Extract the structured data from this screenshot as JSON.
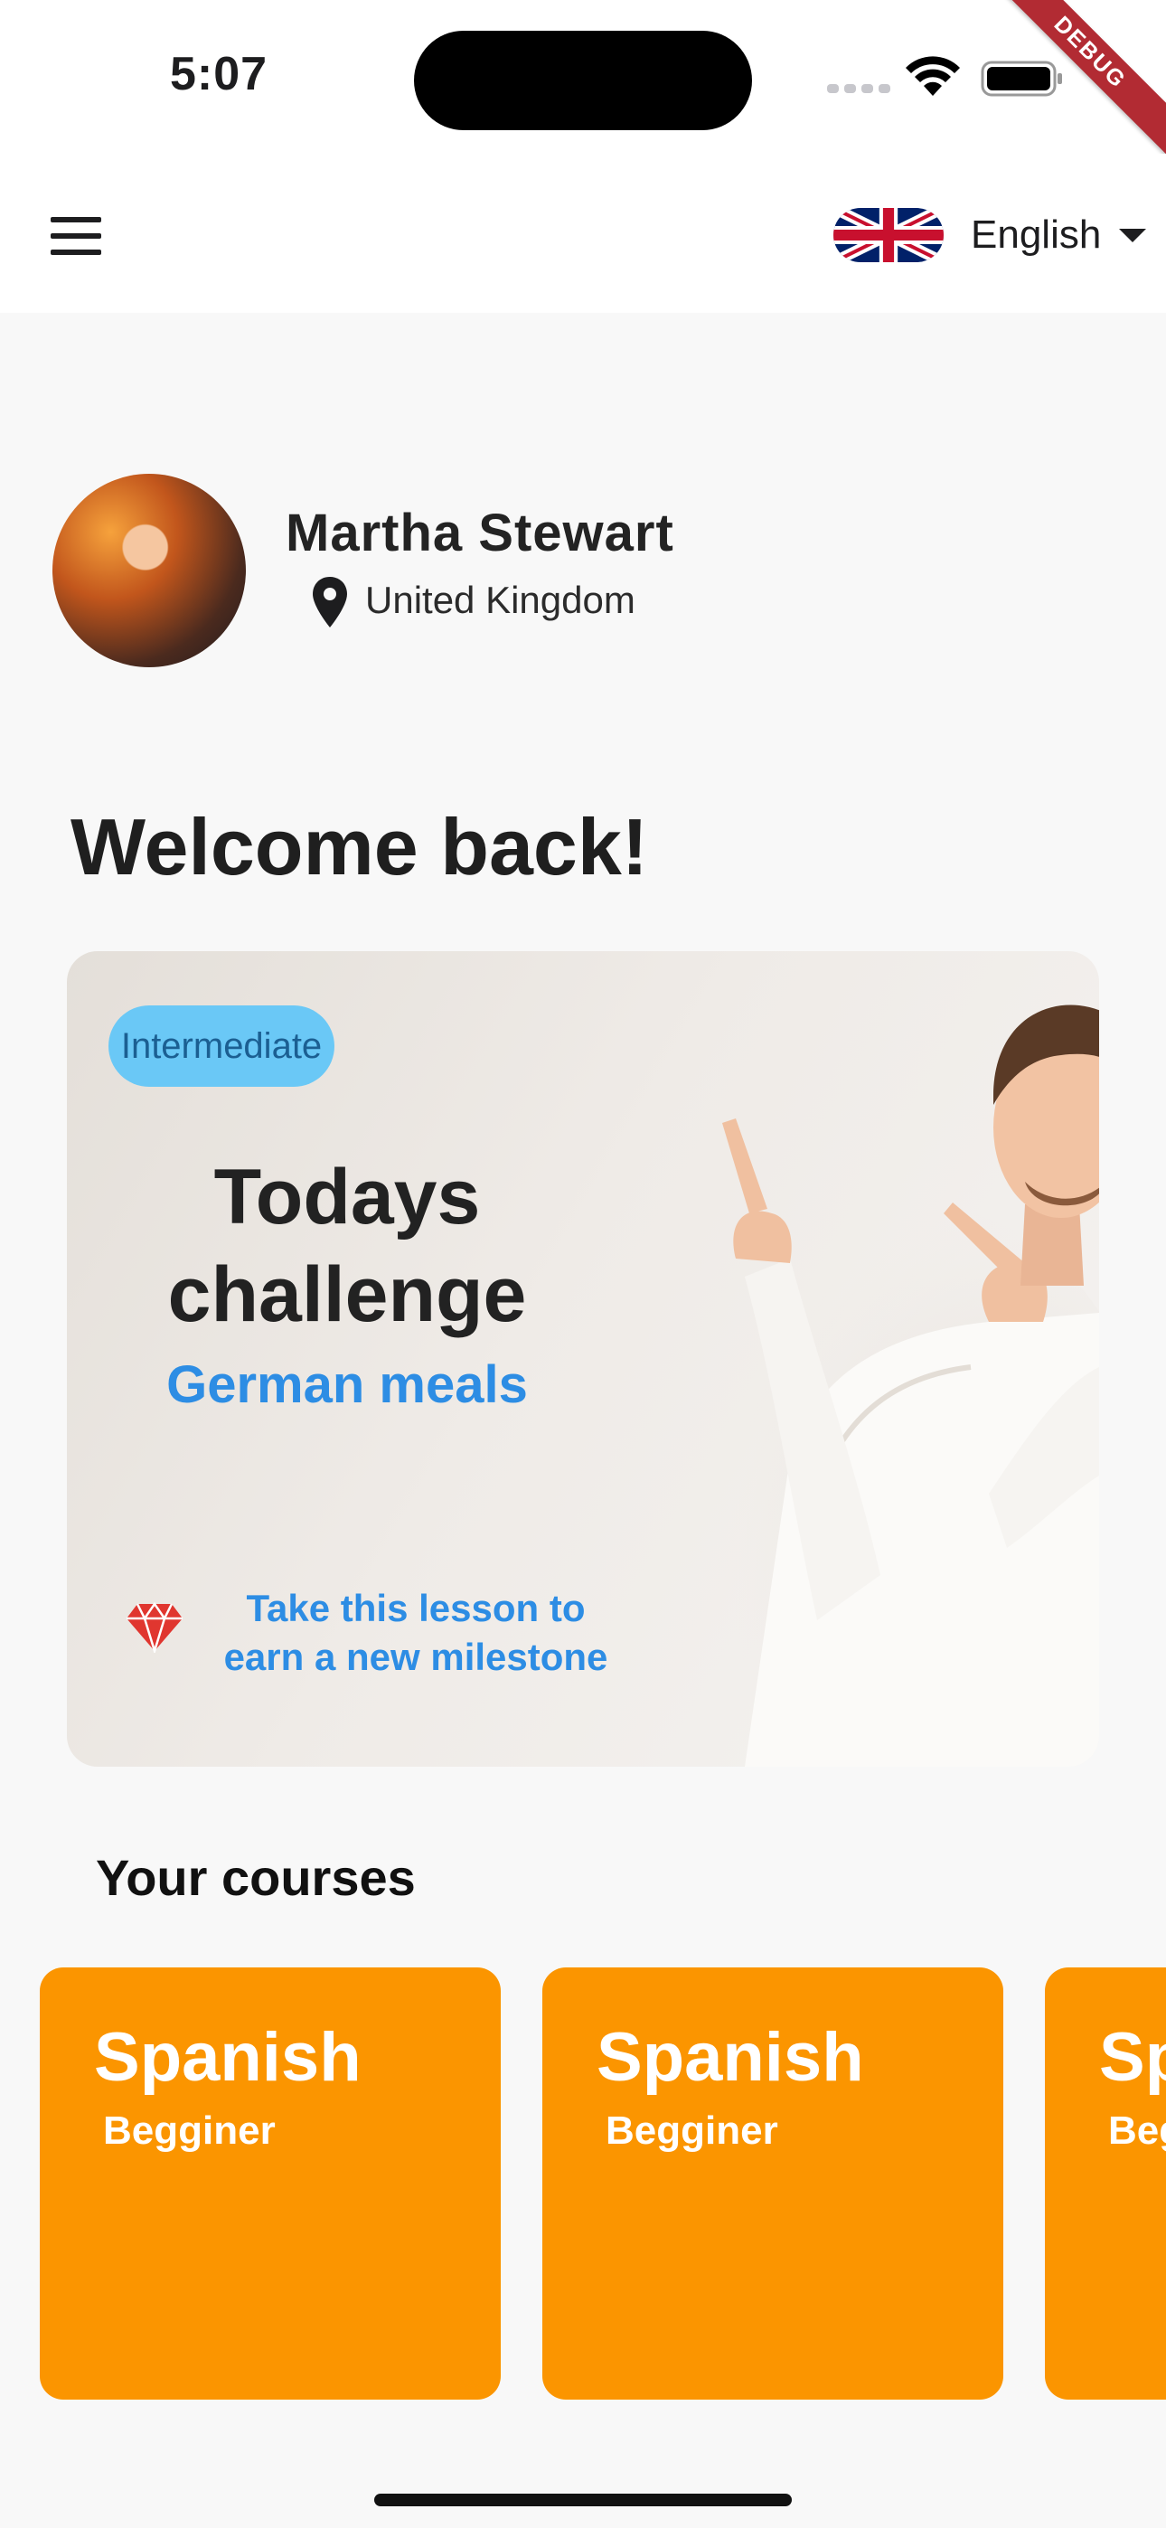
{
  "status_bar": {
    "time": "5:07",
    "debug_label": "DEBUG"
  },
  "app_bar": {
    "menu_icon": "hamburger-menu-icon",
    "language": {
      "flag": "uk-flag-icon",
      "label": "English"
    }
  },
  "profile": {
    "name": "Martha Stewart",
    "country": "United Kingdom"
  },
  "welcome": "Welcome back!",
  "challenge": {
    "level": "Intermediate",
    "title": "Todays challenge",
    "subtitle": "German meals",
    "milestone_text": "Take this lesson to earn a new milestone"
  },
  "courses": {
    "title": "Your courses",
    "items": [
      {
        "name": "Spanish",
        "level": "Begginer"
      },
      {
        "name": "Spanish",
        "level": "Begginer"
      },
      {
        "name": "Spanish",
        "level": "Begginer"
      }
    ]
  },
  "colors": {
    "course_card": "#fb9500",
    "accent_blue": "#2d8de4",
    "badge_bg": "#6ac8f6"
  }
}
